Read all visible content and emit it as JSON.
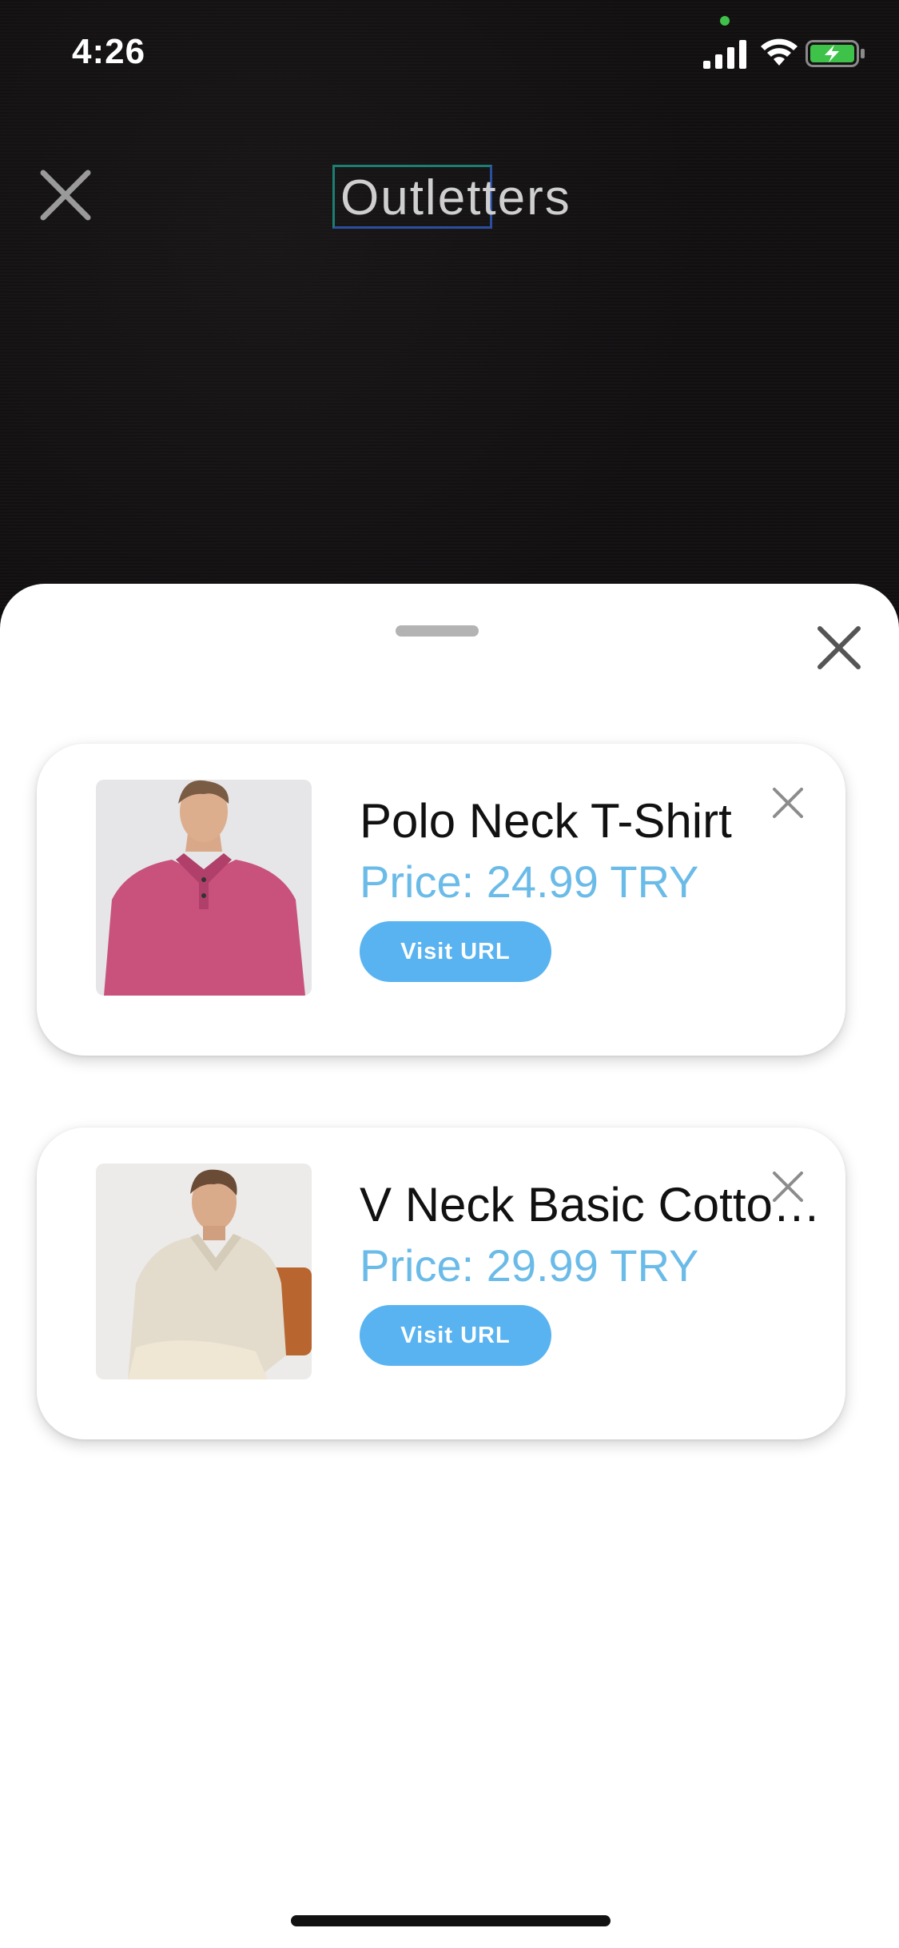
{
  "status_bar": {
    "time": "4:26"
  },
  "header": {
    "brand": "Outletters"
  },
  "icons": {
    "camera_close": "close-icon",
    "sheet_close": "close-icon",
    "card_dismiss": "close-icon",
    "signal": "signal-icon",
    "wifi": "wifi-icon",
    "battery": "battery-charging-icon"
  },
  "colors": {
    "accent": "#58b3f0",
    "price": "#6bbbe8",
    "battery": "#3ec24a"
  },
  "products": [
    {
      "title": "Polo Neck T-Shirt",
      "price": "Price: 24.99 TRY",
      "button": "Visit URL"
    },
    {
      "title": "V Neck Basic Cotto…",
      "price": "Price: 29.99 TRY",
      "button": "Visit URL"
    }
  ]
}
